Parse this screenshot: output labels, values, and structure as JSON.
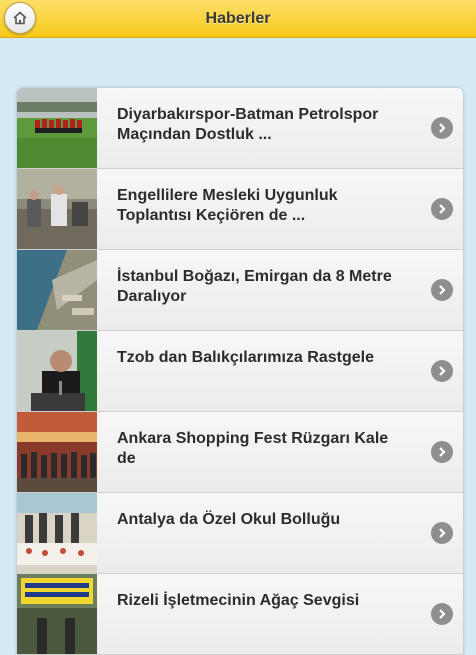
{
  "header": {
    "title": "Haberler",
    "home_icon": "home-icon"
  },
  "news": [
    {
      "title": "Diyarbakırspor-Batman Petrolspor Maçından Dostluk ..."
    },
    {
      "title": "Engellilere Mesleki Uygunluk Toplantısı Keçiören de ..."
    },
    {
      "title": "İstanbul Boğazı, Emirgan da 8 Metre Daralıyor"
    },
    {
      "title": "Tzob dan Balıkçılarımıza Rastgele"
    },
    {
      "title": "Ankara Shopping Fest Rüzgarı Kale de"
    },
    {
      "title": "Antalya da Özel Okul Bolluğu"
    },
    {
      "title": "Rizeli İşletmecinin Ağaç Sevgisi"
    }
  ],
  "colors": {
    "header": "#f6c81a",
    "background": "#d3eaf6",
    "arrow": "#8e8e8e"
  }
}
